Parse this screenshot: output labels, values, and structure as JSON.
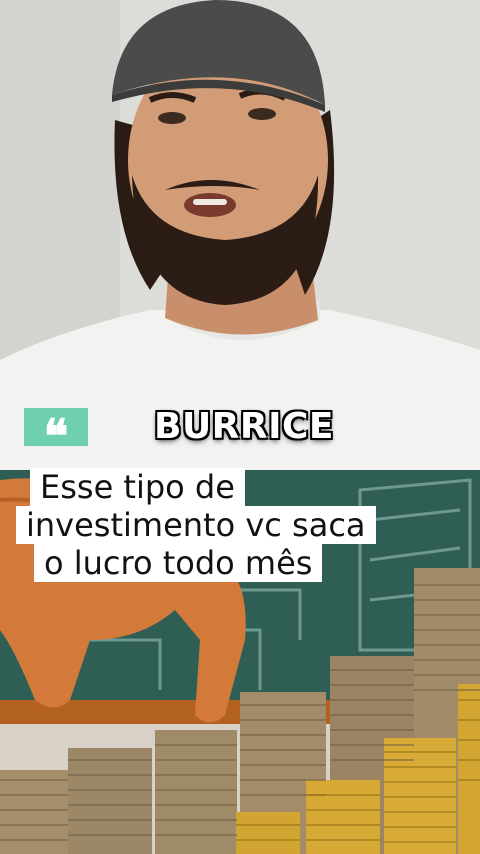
{
  "video": {
    "quote_mark": "❝",
    "headline": "BURRICE",
    "caption_lines": [
      "Esse tipo de",
      "investimento vc saca",
      "o lucro todo mês"
    ],
    "quote_badge_color": "#6fd0b0",
    "caption_bg_color": "#ffffff"
  }
}
